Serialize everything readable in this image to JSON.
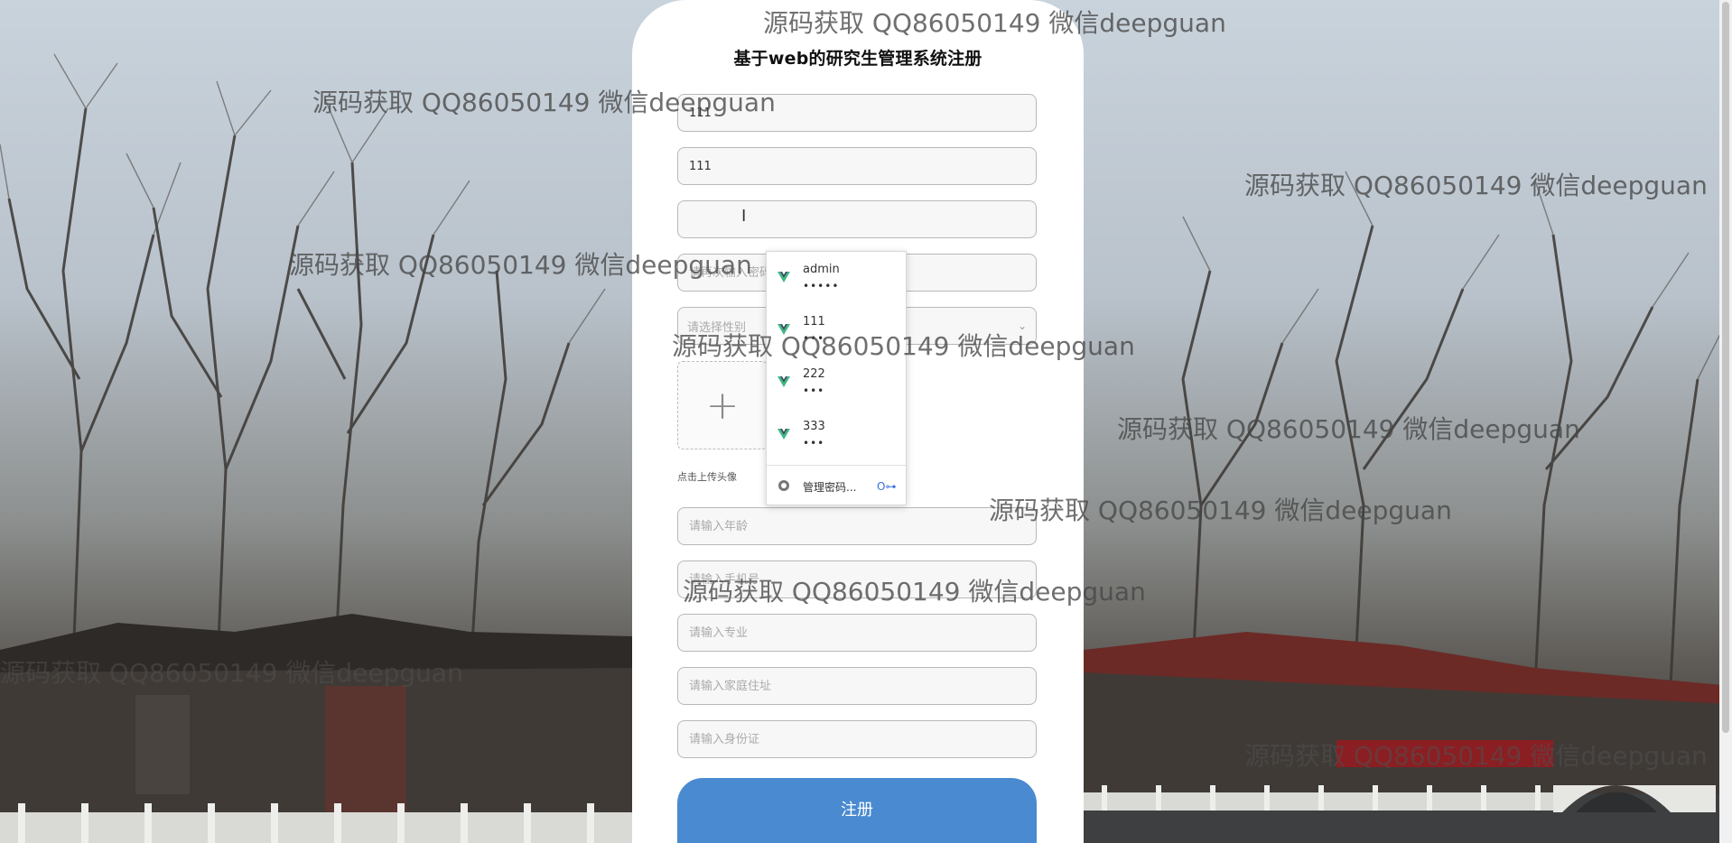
{
  "form": {
    "title": "基于web的研究生管理系统注册",
    "fields": [
      {
        "name": "account-field",
        "value": "111",
        "placeholder": ""
      },
      {
        "name": "name-field",
        "value": "111",
        "placeholder": ""
      },
      {
        "name": "password-field",
        "value": "",
        "placeholder": ""
      },
      {
        "name": "confirm-password-field",
        "value": "",
        "placeholder": "请再次输入密码"
      },
      {
        "name": "gender-select",
        "value": "",
        "placeholder": "请选择性别"
      },
      {
        "name": "age-field",
        "value": "",
        "placeholder": "请输入年龄"
      },
      {
        "name": "phone-field",
        "value": "",
        "placeholder": "请输入手机号"
      },
      {
        "name": "major-field",
        "value": "",
        "placeholder": "请输入专业"
      },
      {
        "name": "address-field",
        "value": "",
        "placeholder": "请输入家庭住址"
      },
      {
        "name": "id-card-field",
        "value": "",
        "placeholder": "请输入身份证"
      }
    ],
    "upload_label": "点击上传头像",
    "submit_label": "注册"
  },
  "autofill": {
    "accounts": [
      {
        "username": "admin",
        "password_mask": "•••••"
      },
      {
        "username": "111",
        "password_mask": "•••"
      },
      {
        "username": "222",
        "password_mask": "•••"
      },
      {
        "username": "333",
        "password_mask": "•••"
      }
    ],
    "manage_label": "管理密码...",
    "manage_key_glyph": "O⊶"
  },
  "watermark": {
    "text": "源码获取 QQ86050149 微信deepguan"
  },
  "icons": {
    "upload": "plus-icon",
    "cursor": "text-cursor-icon",
    "account": "vue-logo-icon",
    "manage": "chrome-icon",
    "key": "key-icon"
  }
}
